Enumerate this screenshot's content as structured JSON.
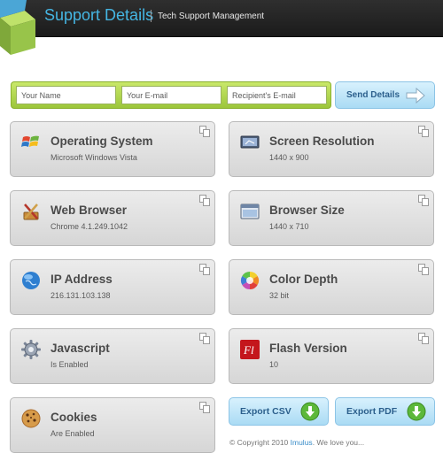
{
  "header": {
    "title": "Support Details",
    "subtitle": "Tech Support Management"
  },
  "form": {
    "name_placeholder": "Your Name",
    "email_placeholder": "Your E-mail",
    "recipient_placeholder": "Recipient's E-mail",
    "send_label": "Send Details"
  },
  "cards": {
    "os": {
      "title": "Operating System",
      "value": "Microsoft Windows Vista",
      "icon": "windows-logo-icon"
    },
    "screen": {
      "title": "Screen Resolution",
      "value": "1440 x 900",
      "icon": "monitor-icon"
    },
    "browser": {
      "title": "Web Browser",
      "value": "Chrome 4.1.249.1042",
      "icon": "browser-tools-icon"
    },
    "browser_size": {
      "title": "Browser Size",
      "value": "1440 x 710",
      "icon": "window-icon"
    },
    "ip": {
      "title": "IP Address",
      "value": "216.131.103.138",
      "icon": "globe-icon"
    },
    "color": {
      "title": "Color Depth",
      "value": "32 bit",
      "icon": "color-wheel-icon"
    },
    "js": {
      "title": "Javascript",
      "value": "Is Enabled",
      "icon": "gear-icon"
    },
    "flash": {
      "title": "Flash Version",
      "value": "10",
      "icon": "flash-icon"
    },
    "cookies": {
      "title": "Cookies",
      "value": "Are Enabled",
      "icon": "cookie-icon"
    }
  },
  "export": {
    "csv_label": "Export CSV",
    "pdf_label": "Export PDF"
  },
  "footer": {
    "prefix": "© Copyright 2010",
    "link": "Imulus",
    "suffix": ". We love you..."
  },
  "colors": {
    "header_bg": "#222222",
    "title_blue": "#45b6e3",
    "form_green": "#b2d84d",
    "button_blue": "#bfe6f8"
  }
}
